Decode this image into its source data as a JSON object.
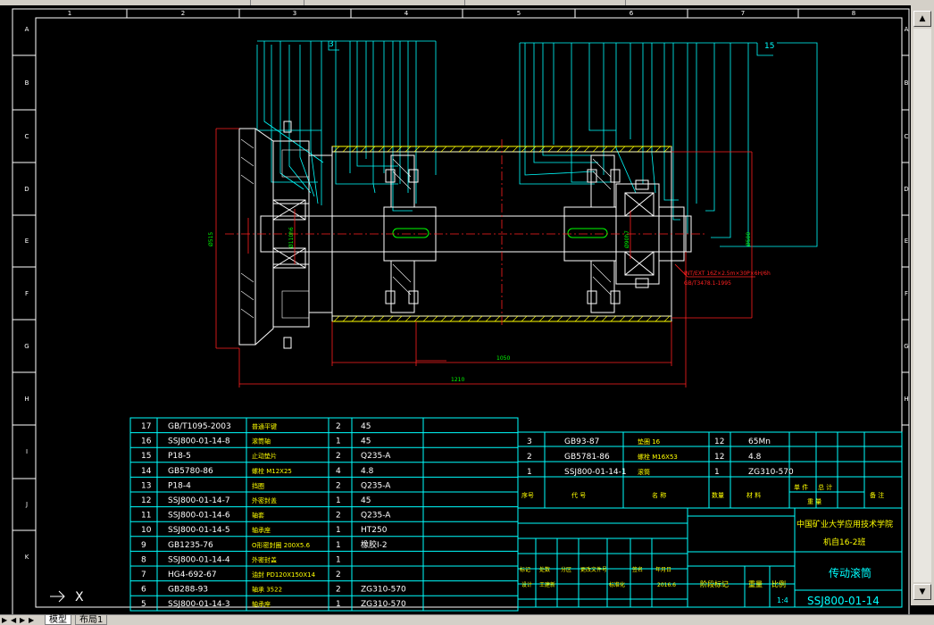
{
  "colors": {
    "background": "#000000",
    "frame": "#ffffff",
    "cyan": "#00ffff",
    "red": "#ff2020",
    "green": "#00ff00",
    "yellow": "#ffff00",
    "white": "#ffffff"
  },
  "tabs": {
    "model": "模型",
    "layout1": "布局1"
  },
  "ucs_label": "X",
  "border": {
    "columns": [
      "1",
      "2",
      "3",
      "4",
      "5",
      "6",
      "7",
      "8"
    ],
    "rows": [
      "A",
      "B",
      "C",
      "D",
      "E",
      "F",
      "G",
      "H",
      "I",
      "J",
      "K"
    ]
  },
  "drawing": {
    "balloon_left": "3",
    "balloon_right": "15",
    "dim_overall": "1210",
    "dim_drum": "1050",
    "dim_left_dia": "Ø515",
    "dim_right_dia": "Ø500",
    "dim_bore_left": "Ø110h6",
    "dim_bore_right": "Ø90h7",
    "key_note": "INT/EXT 16Z×2.5m×30P×6H/6h",
    "key_note_2": "GB/T3478.1-1995"
  },
  "bom_left": {
    "rows": [
      {
        "no": "17",
        "code": "GB/T1095-2003",
        "name": "普通平键",
        "qty": "2",
        "mat": "45"
      },
      {
        "no": "16",
        "code": "SSJ800-01-14-8",
        "name": "滚筒轴",
        "qty": "1",
        "mat": "45"
      },
      {
        "no": "15",
        "code": "P18-5",
        "name": "止动垫片",
        "qty": "2",
        "mat": "Q235-A"
      },
      {
        "no": "14",
        "code": "GB5780-86",
        "name": "螺栓 M12X25",
        "qty": "4",
        "mat": "4.8"
      },
      {
        "no": "13",
        "code": "P18-4",
        "name": "挡圈",
        "qty": "2",
        "mat": "Q235-A"
      },
      {
        "no": "12",
        "code": "SSJ800-01-14-7",
        "name": "外密封盖",
        "qty": "1",
        "mat": "45"
      },
      {
        "no": "11",
        "code": "SSJ800-01-14-6",
        "name": "轴套",
        "qty": "2",
        "mat": "Q235-A"
      },
      {
        "no": "10",
        "code": "SSJ800-01-14-5",
        "name": "轴承座",
        "qty": "1",
        "mat": "HT250"
      },
      {
        "no": "9",
        "code": "GB1235-76",
        "name": "O形密封圈 200X5.6",
        "qty": "1",
        "mat": "橡胶I-2"
      },
      {
        "no": "8",
        "code": "SSJ800-01-14-4",
        "name": "外密封盖",
        "qty": "1",
        "mat": ""
      },
      {
        "no": "7",
        "code": "HG4-692-67",
        "name": "油封 PD120X150X14",
        "qty": "2",
        "mat": ""
      },
      {
        "no": "6",
        "code": "GB288-93",
        "name": "轴承 3522",
        "qty": "2",
        "mat": "ZG310-570"
      },
      {
        "no": "5",
        "code": "SSJ800-01-14-3",
        "name": "轴承座",
        "qty": "1",
        "mat": "ZG310-570"
      }
    ]
  },
  "bom_right": {
    "rows": [
      {
        "no": "3",
        "code": "GB93-87",
        "name": "垫圈 16",
        "qty": "12",
        "mat": "65Mn"
      },
      {
        "no": "2",
        "code": "GB5781-86",
        "name": "螺栓 M16X53",
        "qty": "12",
        "mat": "4.8"
      },
      {
        "no": "1",
        "code": "SSJ800-01-14-1",
        "name": "滚筒",
        "qty": "1",
        "mat": "ZG310-570"
      }
    ],
    "header": {
      "no": "序号",
      "code": "代  号",
      "name": "名  称",
      "qty": "数量",
      "mat": "材  料",
      "unit": "单 件",
      "total": "总 计",
      "weight": "重 量",
      "remark": "备 注"
    }
  },
  "title_block": {
    "school": "中国矿业大学应用技术学院",
    "class": "机自16-2班",
    "drawing_name": "传动滚筒",
    "drawing_no": "SSJ800-01-14",
    "labels": [
      "标记",
      "处数",
      "分区",
      "更改文件号",
      "签名",
      "年月日"
    ],
    "designer_label": "设计",
    "designer": "王建新",
    "std_label": "标准化",
    "date": "2016.6",
    "stage_label": "阶段标记",
    "weight_label": "重量",
    "scale_label": "比例",
    "scale": "1:4"
  }
}
